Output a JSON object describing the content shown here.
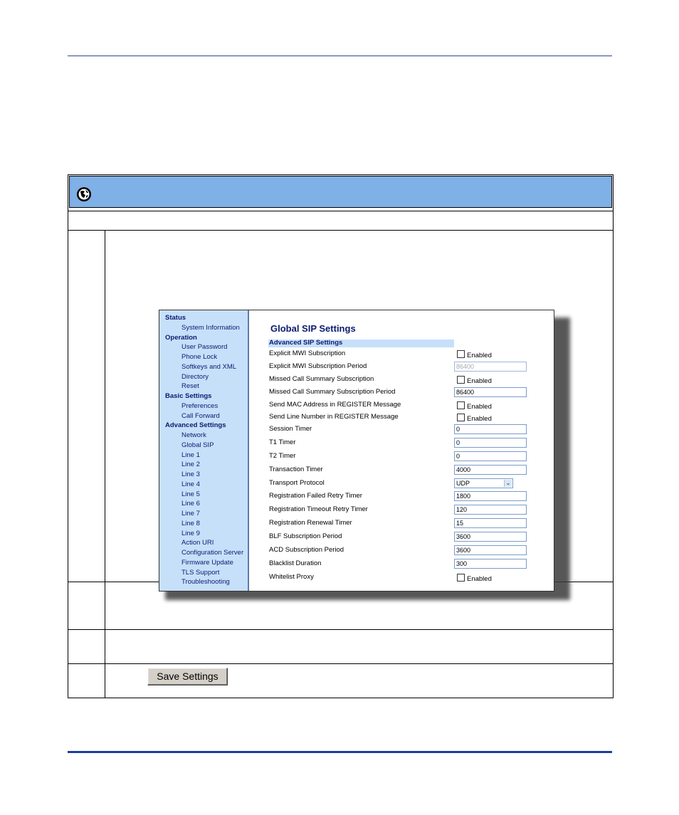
{
  "nav": {
    "items": [
      {
        "label": "Status",
        "level": "head"
      },
      {
        "label": "System Information",
        "level": "sub"
      },
      {
        "label": "Operation",
        "level": "head"
      },
      {
        "label": "User Password",
        "level": "sub"
      },
      {
        "label": "Phone Lock",
        "level": "sub"
      },
      {
        "label": "Softkeys and XML",
        "level": "sub"
      },
      {
        "label": "Directory",
        "level": "sub"
      },
      {
        "label": "Reset",
        "level": "sub"
      },
      {
        "label": "Basic Settings",
        "level": "head"
      },
      {
        "label": "Preferences",
        "level": "sub"
      },
      {
        "label": "Call Forward",
        "level": "sub"
      },
      {
        "label": "Advanced Settings",
        "level": "head"
      },
      {
        "label": "Network",
        "level": "sub"
      },
      {
        "label": "Global SIP",
        "level": "sub"
      },
      {
        "label": "Line 1",
        "level": "sub"
      },
      {
        "label": "Line 2",
        "level": "sub"
      },
      {
        "label": "Line 3",
        "level": "sub"
      },
      {
        "label": "Line 4",
        "level": "sub"
      },
      {
        "label": "Line 5",
        "level": "sub"
      },
      {
        "label": "Line 6",
        "level": "sub"
      },
      {
        "label": "Line 7",
        "level": "sub"
      },
      {
        "label": "Line 8",
        "level": "sub"
      },
      {
        "label": "Line 9",
        "level": "sub"
      },
      {
        "label": "Action URI",
        "level": "sub"
      },
      {
        "label": "Configuration Server",
        "level": "sub"
      },
      {
        "label": "Firmware Update",
        "level": "sub"
      },
      {
        "label": "TLS Support",
        "level": "sub"
      },
      {
        "label": "Troubleshooting",
        "level": "sub"
      }
    ]
  },
  "page": {
    "title": "Global SIP Settings",
    "section": "Advanced SIP Settings"
  },
  "fields": [
    {
      "label": "Explicit MWI Subscription",
      "kind": "checkbox",
      "value": "Enabled",
      "checked": false
    },
    {
      "label": "Explicit MWI Subscription Period",
      "kind": "input",
      "value": "86400",
      "disabled": true
    },
    {
      "label": "Missed Call Summary Subscription",
      "kind": "checkbox",
      "value": "Enabled",
      "checked": false
    },
    {
      "label": "Missed Call Summary Subscription Period",
      "kind": "input",
      "value": "86400"
    },
    {
      "label": "Send MAC Address in REGISTER Message",
      "kind": "checkbox",
      "value": "Enabled",
      "checked": false
    },
    {
      "label": "Send Line Number in REGISTER Message",
      "kind": "checkbox",
      "value": "Enabled",
      "checked": false
    },
    {
      "label": "Session Timer",
      "kind": "input",
      "value": "0"
    },
    {
      "label": "T1 Timer",
      "kind": "input",
      "value": "0"
    },
    {
      "label": "T2 Timer",
      "kind": "input",
      "value": "0"
    },
    {
      "label": "Transaction Timer",
      "kind": "input",
      "value": "4000"
    },
    {
      "label": "Transport Protocol",
      "kind": "select",
      "value": "UDP"
    },
    {
      "label": "Registration Failed Retry Timer",
      "kind": "input",
      "value": "1800"
    },
    {
      "label": "Registration Timeout Retry Timer",
      "kind": "input",
      "value": "120"
    },
    {
      "label": "Registration Renewal Timer",
      "kind": "input",
      "value": "15"
    },
    {
      "label": "BLF Subscription Period",
      "kind": "input",
      "value": "3600"
    },
    {
      "label": "ACD Subscription Period",
      "kind": "input",
      "value": "3600"
    },
    {
      "label": "Blacklist Duration",
      "kind": "input",
      "value": "300"
    },
    {
      "label": "Whitelist Proxy",
      "kind": "checkbox",
      "value": "Enabled",
      "checked": false
    }
  ],
  "save_button": {
    "label": "Save Settings"
  },
  "icons": {
    "header": "globe-icon",
    "select_arrow": "chevron-down-icon"
  },
  "colors": {
    "header_bar": "#7fb0e6",
    "nav_bg": "#c6e0fa",
    "rule": "#1f3d9a"
  }
}
